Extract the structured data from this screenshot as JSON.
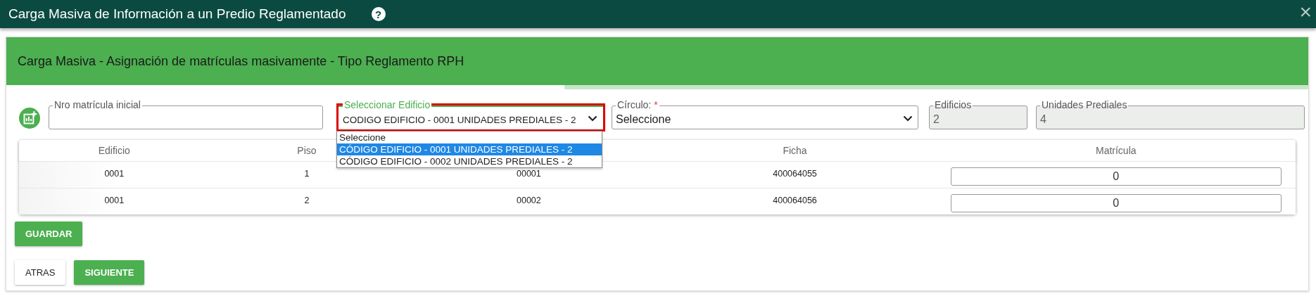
{
  "window": {
    "title": "Carga Masiva de Información a un Predio Reglamentado",
    "help_icon": "?",
    "close_icon": "×"
  },
  "header": {
    "title": "Carga Masiva - Asignación de matrículas masivamente - Tipo Reglamento RPH"
  },
  "form": {
    "matricula_inicial": {
      "label": "Nro matrícula inicial"
    },
    "edificio": {
      "label": "Seleccionar Edificio",
      "value": "CODIGO EDIFICIO - 0001 UNIDADES PREDIALES - 2",
      "expanded": true,
      "options": [
        {
          "label": "Seleccione",
          "selected": false
        },
        {
          "label": "CÓDIGO EDIFICIO - 0001 UNIDADES PREDIALES - 2",
          "selected": true
        },
        {
          "label": "CÓDIGO EDIFICIO - 0002 UNIDADES PREDIALES - 2",
          "selected": false
        }
      ]
    },
    "circulo": {
      "label": "Círculo:",
      "required_mark": "*",
      "value": "Seleccione"
    },
    "edificios": {
      "label": "Edificios",
      "value": "2"
    },
    "unidades": {
      "label": "Unidades Prediales",
      "value": "4"
    }
  },
  "table": {
    "columns": [
      "Edificio",
      "Piso",
      "",
      "Ficha",
      "Matrícula"
    ],
    "rows": [
      {
        "edificio": "0001",
        "piso": "1",
        "column_3": "00001",
        "ficha": "400064055",
        "matricula": "0"
      },
      {
        "edificio": "0001",
        "piso": "2",
        "column_3": "00002",
        "ficha": "400064056",
        "matricula": "0"
      }
    ]
  },
  "buttons": {
    "save": "GUARDAR",
    "back": "ATRAS",
    "next": "SIGUIENTE"
  }
}
